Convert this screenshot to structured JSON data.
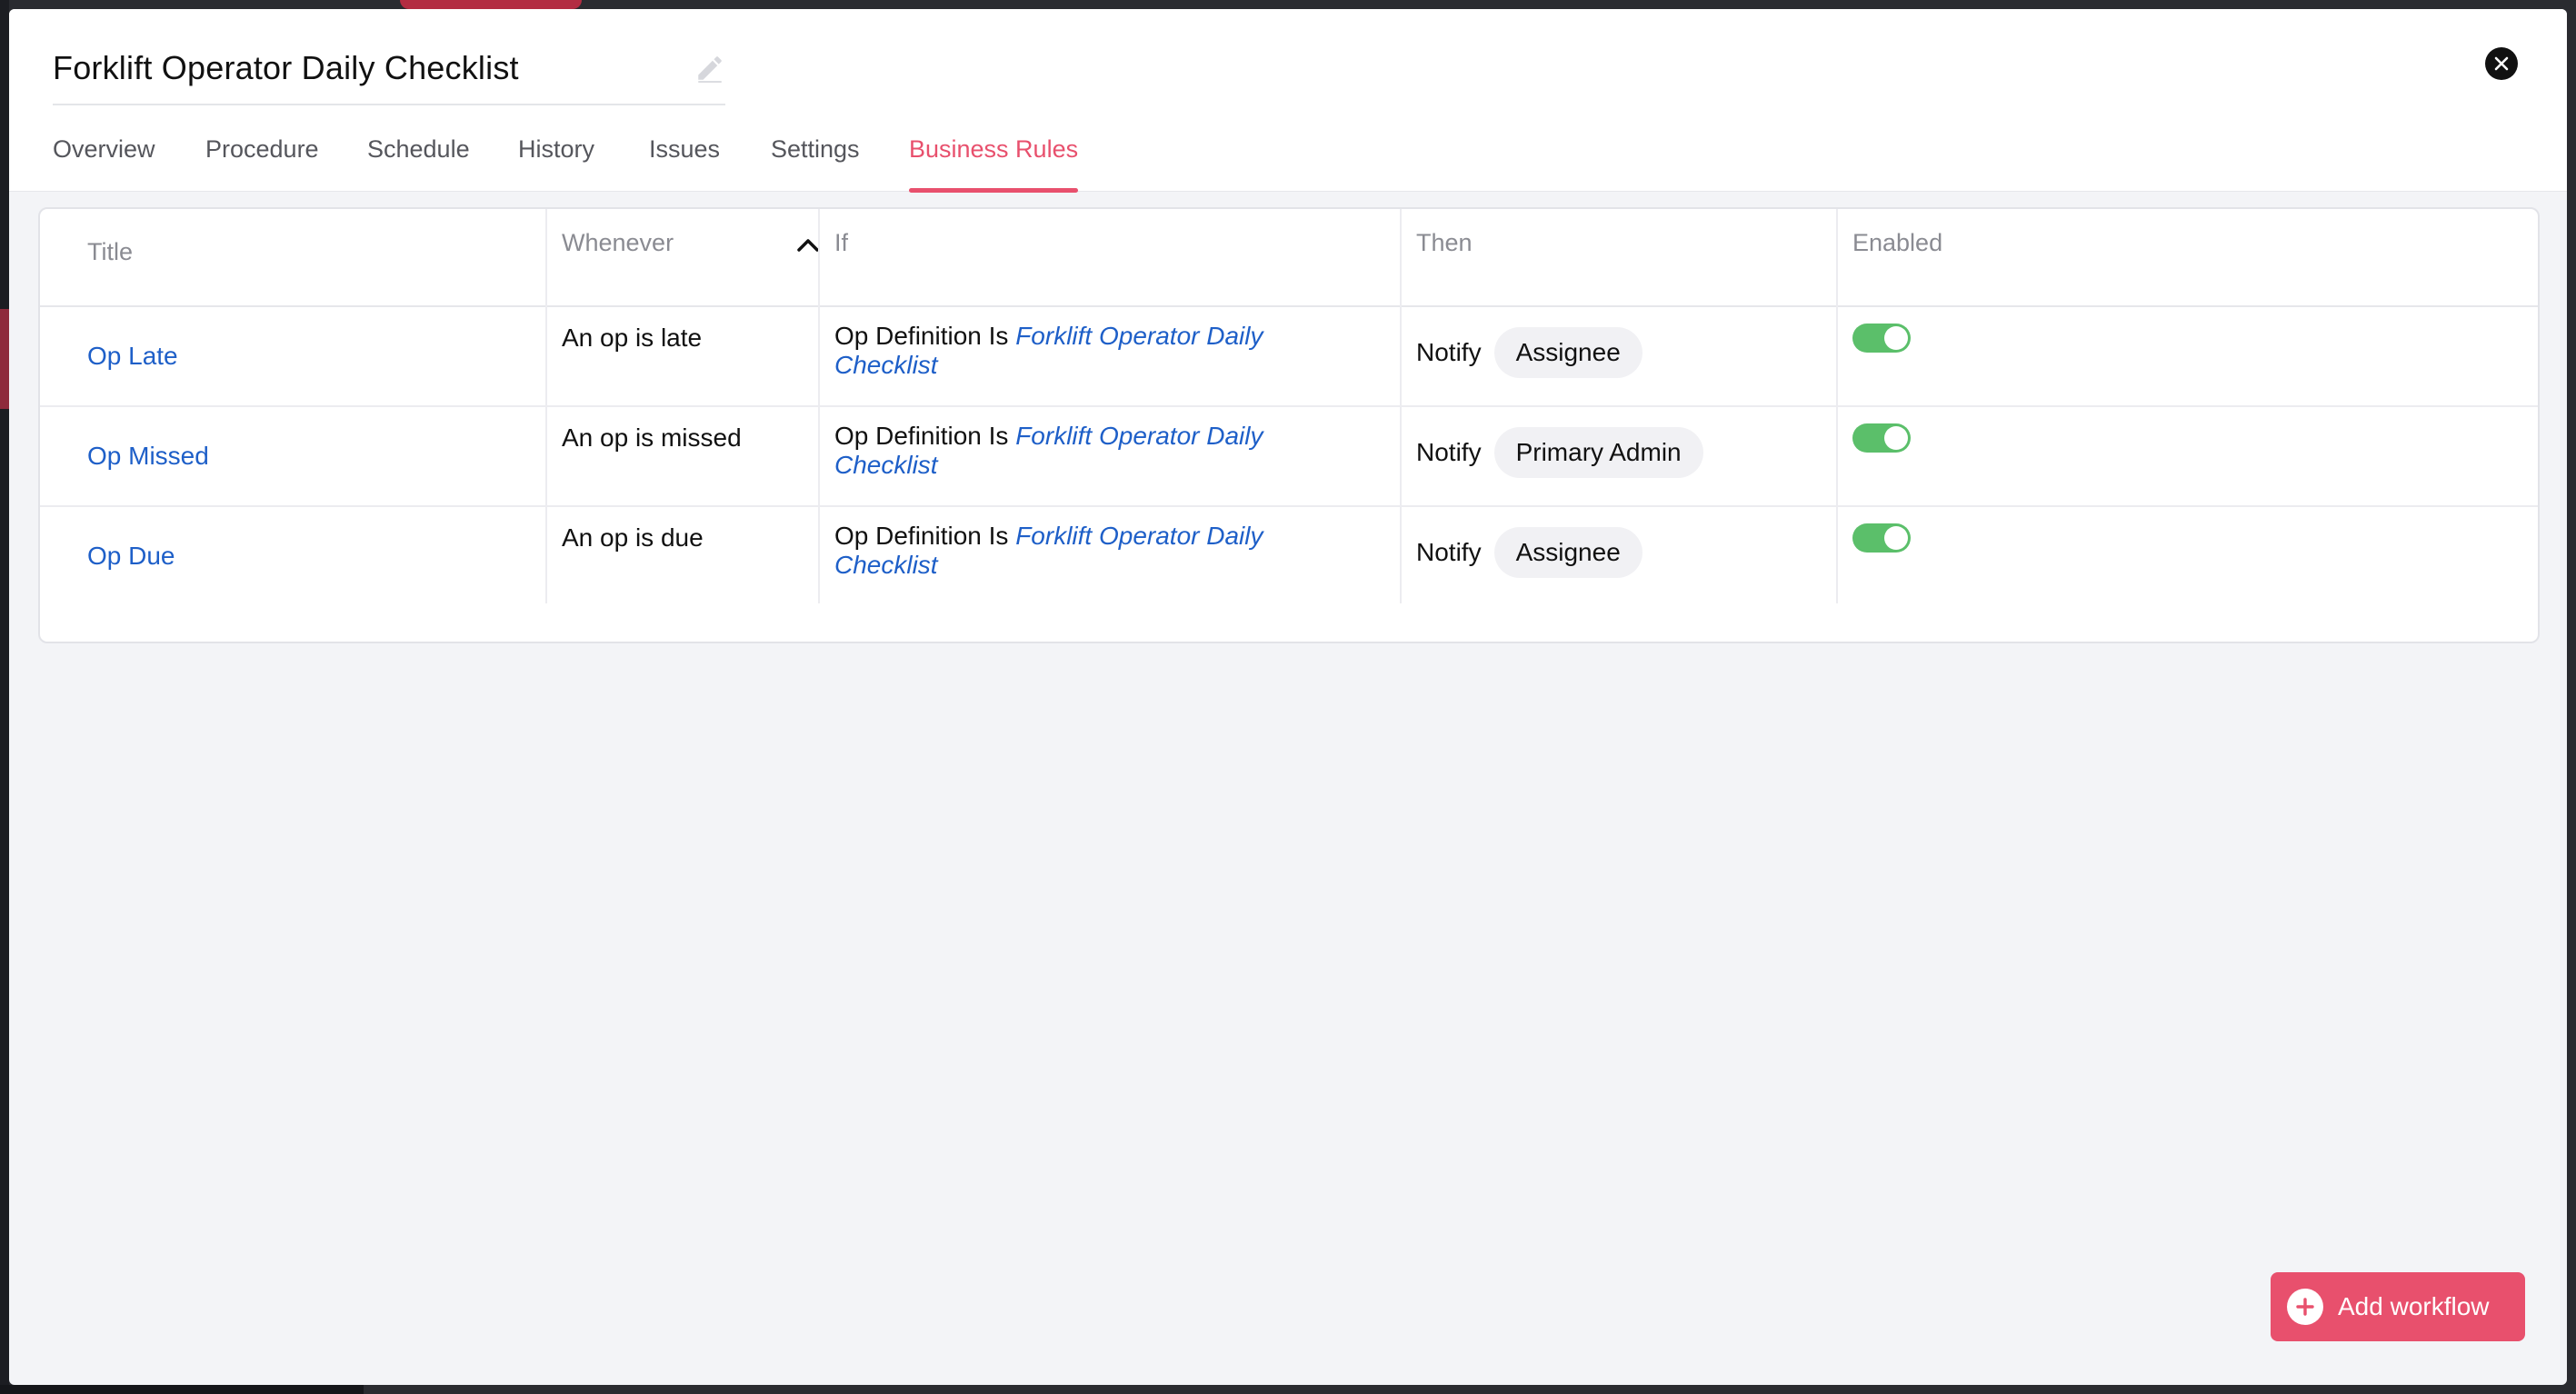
{
  "modal": {
    "title": "Forklift Operator Daily Checklist"
  },
  "tabs": [
    {
      "label": "Overview",
      "active": false
    },
    {
      "label": "Procedure",
      "active": false
    },
    {
      "label": "Schedule",
      "active": false
    },
    {
      "label": "History",
      "active": false
    },
    {
      "label": "Issues",
      "active": false
    },
    {
      "label": "Settings",
      "active": false
    },
    {
      "label": "Business Rules",
      "active": true
    }
  ],
  "table": {
    "columns": {
      "title": "Title",
      "whenever": "Whenever",
      "if": "If",
      "then": "Then",
      "enabled": "Enabled"
    },
    "sort": {
      "column": "whenever",
      "direction": "ascending"
    },
    "rows": [
      {
        "title": "Op Late",
        "whenever": "An op is late",
        "if_prefix": "Op Definition Is",
        "if_value": "Forklift Operator Daily Checklist",
        "then_action": "Notify",
        "then_target": "Assignee",
        "enabled": true
      },
      {
        "title": "Op Missed",
        "whenever": "An op is missed",
        "if_prefix": "Op Definition Is",
        "if_value": "Forklift Operator Daily Checklist",
        "then_action": "Notify",
        "then_target": "Primary Admin",
        "enabled": true
      },
      {
        "title": "Op Due",
        "whenever": "An op is due",
        "if_prefix": "Op Definition Is",
        "if_value": "Forklift Operator Daily Checklist",
        "then_action": "Notify",
        "then_target": "Assignee",
        "enabled": true
      }
    ]
  },
  "actions": {
    "add_workflow_label": "Add workflow"
  },
  "colors": {
    "accent": "#e8506d",
    "link": "#1e5fc8",
    "toggle_on": "#5bbf6a"
  },
  "icons": {
    "edit": "pencil-icon",
    "close": "close-icon",
    "sort": "chevron-up-icon",
    "add": "plus-circle-icon"
  }
}
